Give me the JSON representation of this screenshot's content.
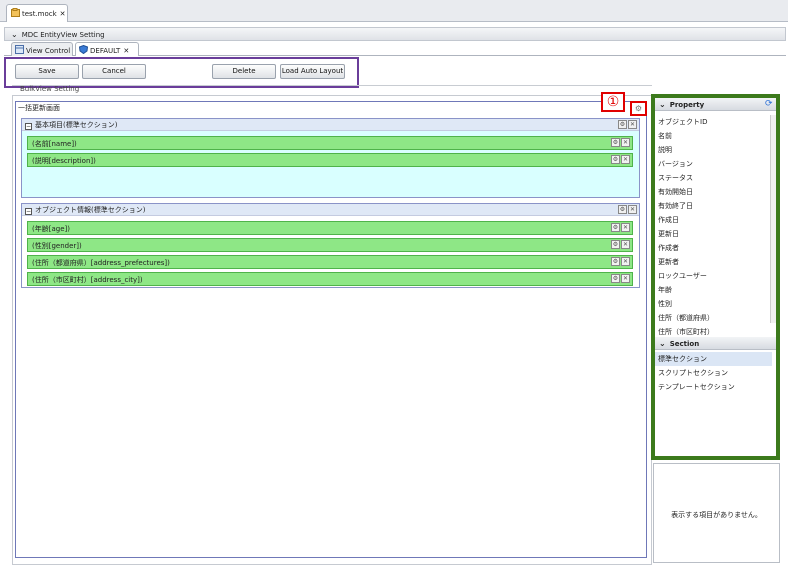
{
  "file_tab": {
    "label": "test.mock",
    "close": "✕"
  },
  "editor": {
    "title": "MDC EntityView Setting"
  },
  "sub_tabs": [
    {
      "label": "View Control"
    },
    {
      "label": "DEFAULT",
      "close": "✕"
    }
  ],
  "toolbar": {
    "save": "Save",
    "cancel": "Cancel",
    "delete": "Delete",
    "load_auto_layout": "Load Auto Layout"
  },
  "bulk": {
    "header": "BulkView Setting",
    "canvas_title": "一括更新画面",
    "marker": "①"
  },
  "sections": [
    {
      "title": "基本項目(標準セクション)",
      "fields": [
        "(名前[name])",
        "(説明[description])"
      ]
    },
    {
      "title": "オブジェクト情報(標準セクション)",
      "fields": [
        "(年齢[age])",
        "(性別[gender])",
        "(住所（都道府県）[address_prefectures])",
        "(住所（市区町村）[address_city])"
      ]
    }
  ],
  "property_panel": {
    "title": "Property",
    "items": [
      "オブジェクトID",
      "名前",
      "説明",
      "バージョン",
      "ステータス",
      "有効開始日",
      "有効終了日",
      "作成日",
      "更新日",
      "作成者",
      "更新者",
      "ロックユーザー",
      "年齢",
      "性別",
      "住所（都道府県）",
      "住所（市区町村）"
    ]
  },
  "section_panel": {
    "title": "Section",
    "items": [
      "標準セクション",
      "スクリプトセクション",
      "テンプレートセクション"
    ],
    "selected_index": 0
  },
  "description_panel": {
    "message": "表示する項目がありません。"
  },
  "colors": {
    "toolbar_highlight": "#6a3d9a",
    "marker_red": "#e00000",
    "panel_highlight": "#3c7a1c",
    "field_green": "#8ee786",
    "section_cyan": "#d9ffff"
  }
}
